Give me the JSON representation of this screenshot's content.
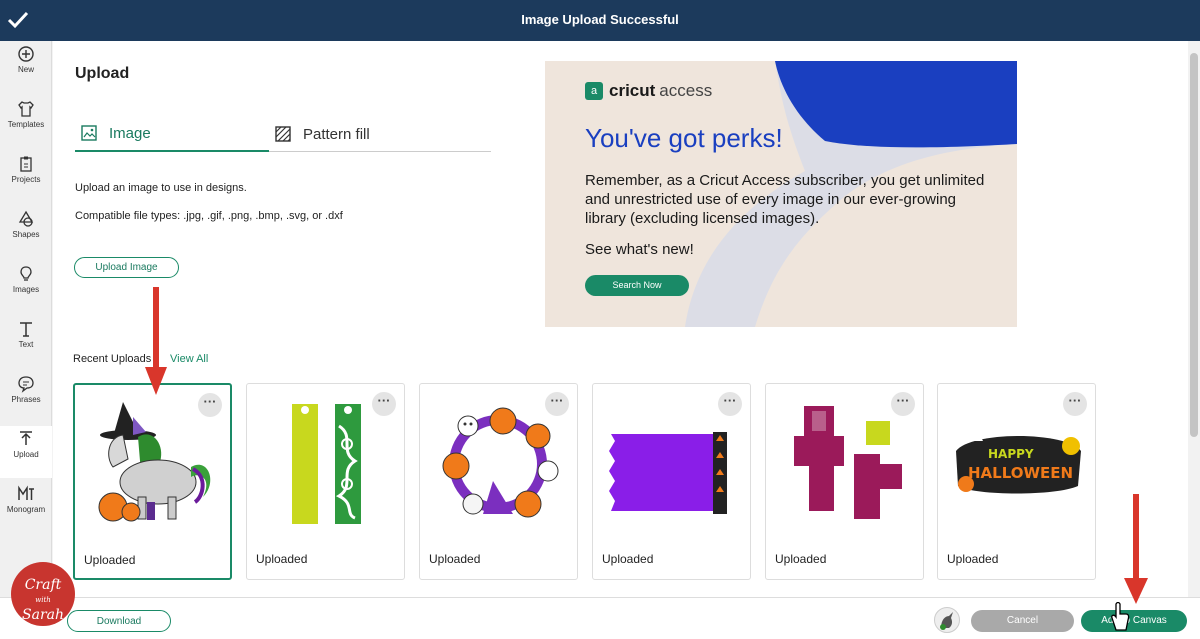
{
  "header": {
    "title": "Image Upload Successful",
    "check_icon": "checkmark-icon"
  },
  "sidebar": {
    "items": [
      {
        "label": "New",
        "icon": "plus-circle-icon"
      },
      {
        "label": "Templates",
        "icon": "shirt-icon"
      },
      {
        "label": "Projects",
        "icon": "clipboard-icon"
      },
      {
        "label": "Shapes",
        "icon": "shapes-icon"
      },
      {
        "label": "Images",
        "icon": "lightbulb-icon"
      },
      {
        "label": "Text",
        "icon": "text-icon"
      },
      {
        "label": "Phrases",
        "icon": "speech-bubble-icon"
      },
      {
        "label": "Upload",
        "icon": "upload-icon",
        "active": true
      },
      {
        "label": "Monogram",
        "icon": "monogram-icon"
      }
    ]
  },
  "upload": {
    "title": "Upload",
    "tabs": [
      {
        "label": "Image",
        "active": true,
        "icon": "image-icon"
      },
      {
        "label": "Pattern fill",
        "active": false,
        "icon": "pattern-icon"
      }
    ],
    "description": "Upload an image to use in designs.",
    "file_types": "Compatible file types: .jpg, .gif, .png, .bmp, .svg, or .dxf",
    "upload_button": "Upload Image"
  },
  "banner": {
    "brand": "cricut",
    "brand_suffix": "access",
    "headline": "You've got perks!",
    "body": "Remember, as a Cricut Access subscriber, you get unlimited and unrestricted use of every image in our ever-growing library (excluding licensed images).",
    "sub": "See what's new!",
    "button": "Search Now"
  },
  "recent": {
    "label": "Recent Uploads",
    "view_all": "View All",
    "cards": [
      {
        "label": "Uploaded",
        "selected": true,
        "thumb": "unicorn-witch"
      },
      {
        "label": "Uploaded",
        "selected": false,
        "thumb": "bookmarks"
      },
      {
        "label": "Uploaded",
        "selected": false,
        "thumb": "halloween-wreath"
      },
      {
        "label": "Uploaded",
        "selected": false,
        "thumb": "purple-banner"
      },
      {
        "label": "Uploaded",
        "selected": false,
        "thumb": "treat-box"
      },
      {
        "label": "Uploaded",
        "selected": false,
        "thumb": "happy-halloween-sign"
      }
    ]
  },
  "footer": {
    "download": "Download",
    "cancel": "Cancel",
    "add_to_canvas": "Add to Canvas"
  },
  "watermark": {
    "line1": "Craft",
    "line2": "with",
    "line3": "Sarah"
  },
  "colors": {
    "header": "#1c3a5c",
    "accent": "#1a8a67",
    "headline": "#1a3fc0",
    "arrow": "#d9362b"
  }
}
